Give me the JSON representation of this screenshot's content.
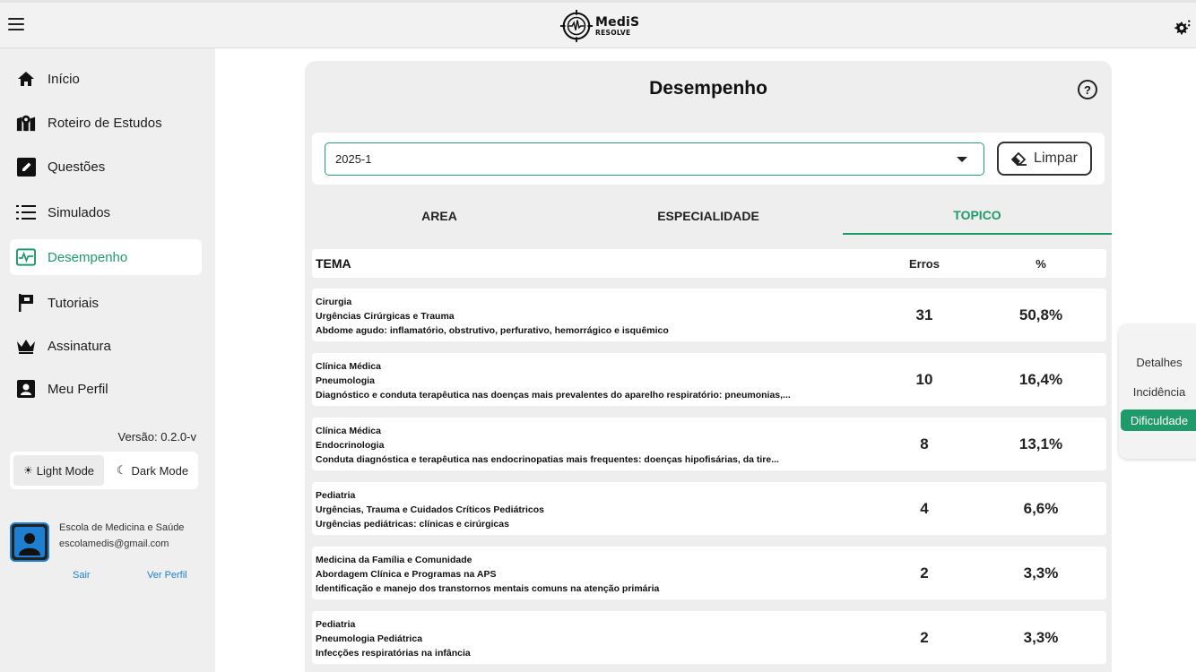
{
  "app": {
    "logo_title": "MediS",
    "logo_subtitle": "RESOLVE",
    "icons": {
      "menu": "hamburger-icon",
      "settings": "gear-icon"
    }
  },
  "sidebar": {
    "items": [
      {
        "label": "Início",
        "icon": "home-icon",
        "active": false
      },
      {
        "label": "Roteiro de Estudos",
        "icon": "map-marker-icon",
        "active": false
      },
      {
        "label": "Questões",
        "icon": "edit-icon",
        "active": false
      },
      {
        "label": "Simulados",
        "icon": "list-icon",
        "active": false
      },
      {
        "label": "Desempenho",
        "icon": "chart-icon",
        "active": true
      },
      {
        "label": "Tutoriais",
        "icon": "flag-icon",
        "active": false
      },
      {
        "label": "Assinatura",
        "icon": "crown-icon",
        "active": false
      },
      {
        "label": "Meu Perfil",
        "icon": "profile-icon",
        "active": false
      }
    ],
    "version": "Versão: 0.2.0-v",
    "light_mode": "Light Mode",
    "dark_mode": "Dark Mode",
    "profile": {
      "name": "Escola de Medicina e Saúde",
      "email": "escolamedis@gmail.com",
      "logout": "Sair",
      "view_profile": "Ver Perfil"
    }
  },
  "main": {
    "title": "Desempenho",
    "help": "?",
    "period_select": "2025-1",
    "clear_label": "Limpar",
    "tabs": [
      {
        "label": "AREA",
        "active": false
      },
      {
        "label": "ESPECIALIDADE",
        "active": false
      },
      {
        "label": "TOPICO",
        "active": true
      }
    ],
    "columns": {
      "tema": "TEMA",
      "erros": "Erros",
      "pct": "%"
    },
    "rows": [
      {
        "area": "Cirurgia",
        "especialidade": "Urgências Cirúrgicas e Trauma",
        "topico": "Abdome agudo: inflamatório, obstrutivo, perfurativo, hemorrágico e isquêmico",
        "erros": "31",
        "pct": "50,8%"
      },
      {
        "area": "Clínica Médica",
        "especialidade": "Pneumologia",
        "topico": "Diagnóstico e conduta terapêutica nas doenças mais prevalentes do aparelho respiratório: pneumonias,...",
        "erros": "10",
        "pct": "16,4%"
      },
      {
        "area": "Clínica Médica",
        "especialidade": "Endocrinologia",
        "topico": "Conduta diagnóstica e terapêutica nas endocrinopatias mais frequentes: doenças hipofisárias, da tire...",
        "erros": "8",
        "pct": "13,1%"
      },
      {
        "area": "Pediatria",
        "especialidade": "Urgências, Trauma e Cuidados Críticos Pediátricos",
        "topico": "Urgências pediátricas: clínicas e cirúrgicas",
        "erros": "4",
        "pct": "6,6%"
      },
      {
        "area": "Medicina da Família e Comunidade",
        "especialidade": "Abordagem Clínica e Programas na APS",
        "topico": "Identificação e manejo dos transtornos mentais comuns na atenção primária",
        "erros": "2",
        "pct": "3,3%"
      },
      {
        "area": "Pediatria",
        "especialidade": "Pneumologia Pediátrica",
        "topico": "Infecções respiratórias na infância",
        "erros": "2",
        "pct": "3,3%"
      }
    ]
  },
  "float_tabs": [
    {
      "label": "Detalhes",
      "active": false
    },
    {
      "label": "Incidência",
      "active": false
    },
    {
      "label": "Dificuldade",
      "active": true
    }
  ],
  "colors": {
    "accent": "#1f9a6a",
    "link": "#1e7fd0",
    "avatar_border": "#1e7fd0"
  }
}
